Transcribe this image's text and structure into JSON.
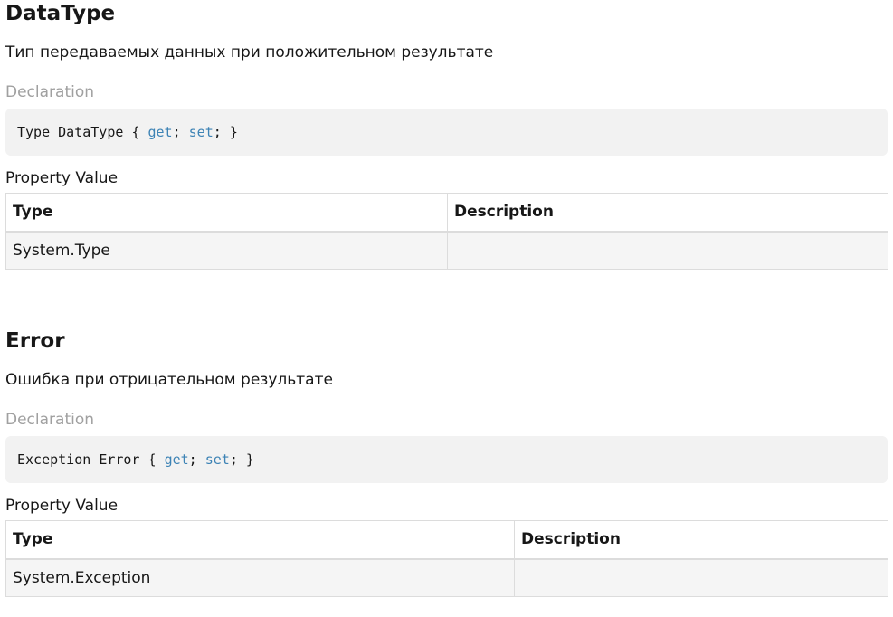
{
  "sections": [
    {
      "title": "DataType",
      "summary": "Тип передаваемых данных при положительном результате",
      "declaration_label": "Declaration",
      "code": {
        "type": "Type",
        "name": "DataType",
        "open": "{",
        "get": "get",
        "sep1": ";",
        "set": "set",
        "sep2": ";",
        "close": "}"
      },
      "property_value_label": "Property Value",
      "table": {
        "headers": [
          "Type",
          "Description"
        ],
        "rows": [
          [
            "System.Type",
            ""
          ]
        ]
      }
    },
    {
      "title": "Error",
      "summary": "Ошибка при отрицательном результате",
      "declaration_label": "Declaration",
      "code": {
        "type": "Exception",
        "name": "Error",
        "open": "{",
        "get": "get",
        "sep1": ";",
        "set": "set",
        "sep2": ";",
        "close": "}"
      },
      "property_value_label": "Property Value",
      "table": {
        "headers": [
          "Type",
          "Description"
        ],
        "rows": [
          [
            "System.Exception",
            ""
          ]
        ]
      }
    }
  ],
  "colors": {
    "keyword": "#3d83b5",
    "muted_label": "#a0a0a0",
    "code_background": "#f2f2f2"
  }
}
